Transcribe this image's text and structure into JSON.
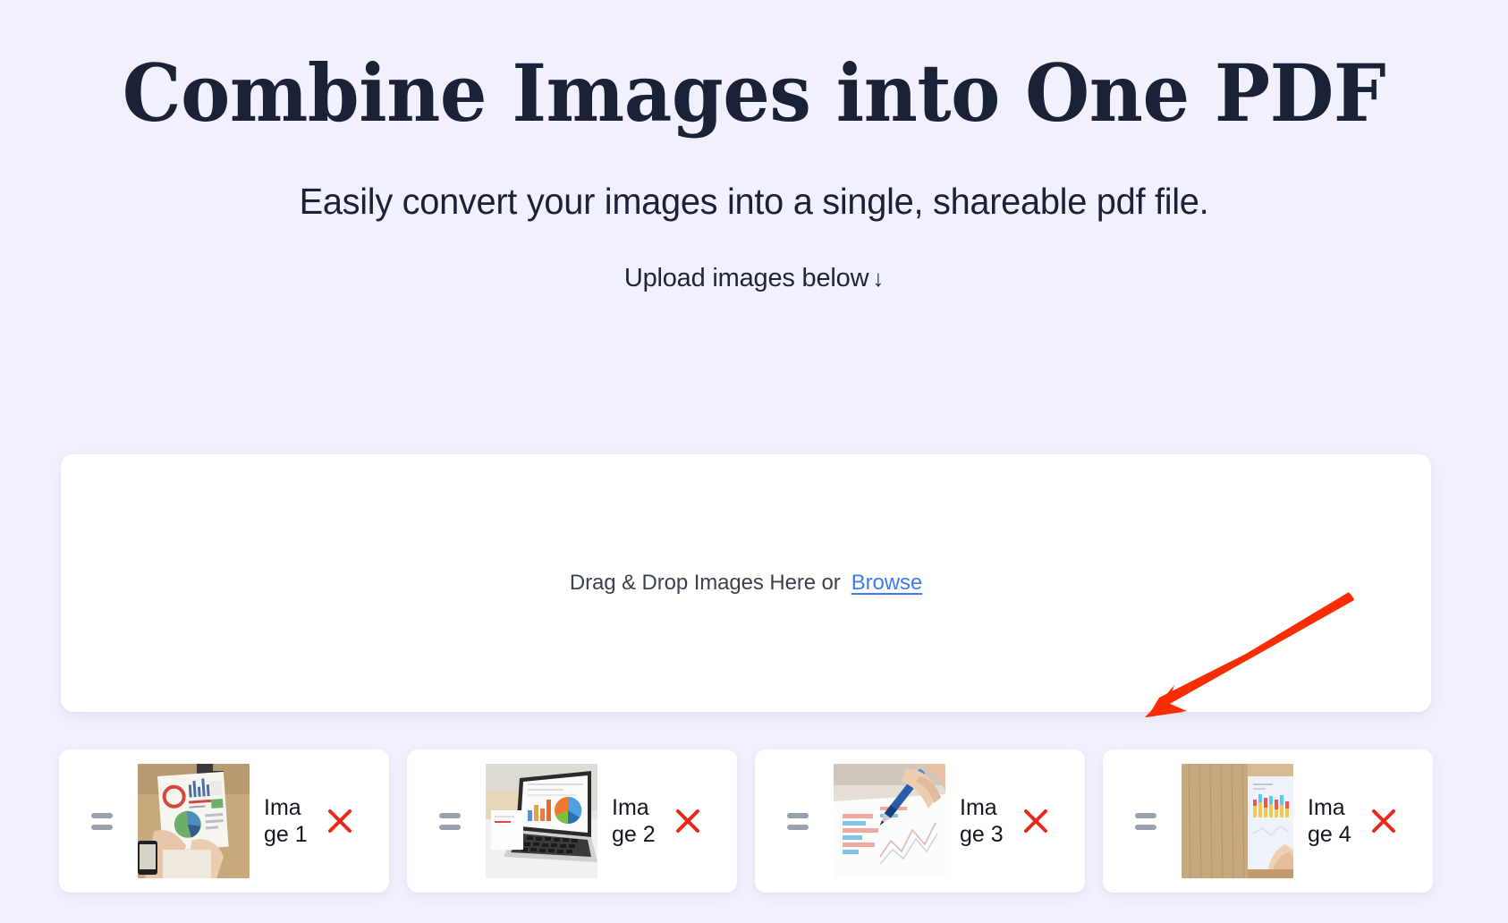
{
  "theme": {
    "page_background": "#f1f0fd",
    "card_background": "#ffffff",
    "title_color": "#1b2237",
    "link_color": "#3d7bf7",
    "remove_icon_color": "#e8291c",
    "handle_color": "#9aa1ae",
    "annotation_arrow_color": "#f92d05"
  },
  "hero": {
    "title": "Combine Images into One PDF",
    "subtitle": "Easily convert your images into a single, shareable pdf file.",
    "hint": "Upload images below",
    "hint_arrow": "↓"
  },
  "dropzone": {
    "prompt": "Drag & Drop Images Here or",
    "browse_label": "Browse"
  },
  "items": [
    {
      "label": "Image 1",
      "thumbnail_alt": "hands-holding-infographic-report-on-wooden-desk",
      "remove_label": "×"
    },
    {
      "label": "Image 2",
      "thumbnail_alt": "laptop-screen-showing-bar-chart-and-pie-chart",
      "remove_label": "×"
    },
    {
      "label": "Image 3",
      "thumbnail_alt": "hand-with-blue-pen-marking-charts-on-paper",
      "remove_label": "×"
    },
    {
      "label": "Image 4",
      "thumbnail_alt": "printed-bar-chart-on-wooden-desk-with-pointing-finger",
      "remove_label": "×"
    }
  ],
  "annotation": {
    "type": "red-arrow",
    "points_to": "image-4-list-item"
  }
}
